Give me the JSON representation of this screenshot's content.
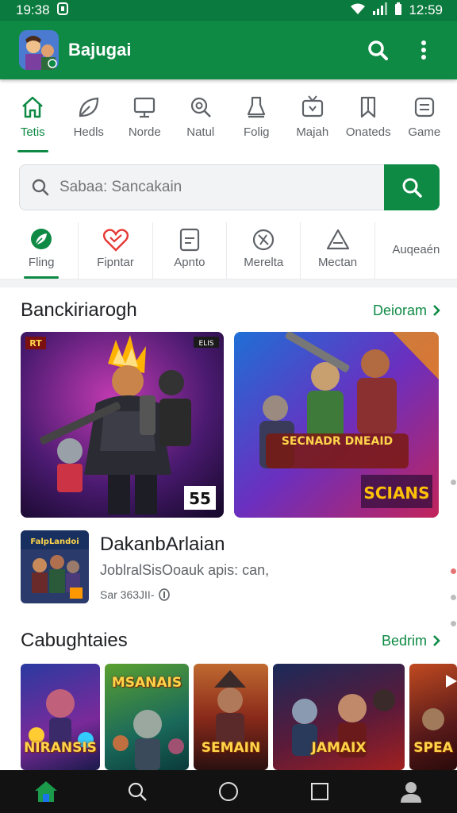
{
  "status": {
    "time_left": "19:38",
    "time_right": "12:59"
  },
  "appbar": {
    "title": "Bajugai"
  },
  "categories": [
    {
      "label": "Tetis",
      "icon": "home-icon",
      "active": true
    },
    {
      "label": "Hedls",
      "icon": "leaf-icon",
      "active": false
    },
    {
      "label": "Norde",
      "icon": "monitor-icon",
      "active": false
    },
    {
      "label": "Natul",
      "icon": "gear-search-icon",
      "active": false
    },
    {
      "label": "Folig",
      "icon": "trophy-icon",
      "active": false
    },
    {
      "label": "Majah",
      "icon": "tv-icon",
      "active": false
    },
    {
      "label": "Onateds",
      "icon": "bookmark-icon",
      "active": false
    },
    {
      "label": "Game",
      "icon": "gamepad-icon",
      "active": false
    }
  ],
  "search": {
    "placeholder": "Sabaa: Sancakain"
  },
  "filters": [
    {
      "label": "Fling",
      "icon": "leaf-badge-icon",
      "active": true
    },
    {
      "label": "Fipntar",
      "icon": "heart-icon",
      "active": false
    },
    {
      "label": "Apnto",
      "icon": "document-icon",
      "active": false
    },
    {
      "label": "Merelta",
      "icon": "compass-icon",
      "active": false
    },
    {
      "label": "Mectan",
      "icon": "warning-icon",
      "active": false
    },
    {
      "label": "Auqeaén",
      "icon": "",
      "active": false
    }
  ],
  "section1": {
    "title": "Banckiriarogh",
    "link": "Deioram"
  },
  "banners": [
    {
      "badge_left": "RT",
      "badge_right": "ELIS",
      "corner_tag": "55"
    },
    {
      "headline": "SECNADR DNEAID",
      "subline": "SCIANS"
    }
  ],
  "featured": {
    "name": "DakanbArlaian",
    "subtitle": "JoblralSisOoauk apis: can,",
    "meta": "Sar 363JII-",
    "thumb_title": "FalpLandoi"
  },
  "section2": {
    "title": "Cabughtaies",
    "link": "Bedrim"
  },
  "tiles": [
    {
      "label": "NIRANSIS"
    },
    {
      "label": "MSANAIS"
    },
    {
      "label": "SEMAIN"
    },
    {
      "label": "JAMAIX"
    },
    {
      "label": "SPEA"
    }
  ],
  "colors": {
    "brand": "#0e8a45",
    "statusbar": "#0b7a3e",
    "navbar": "#121212"
  }
}
